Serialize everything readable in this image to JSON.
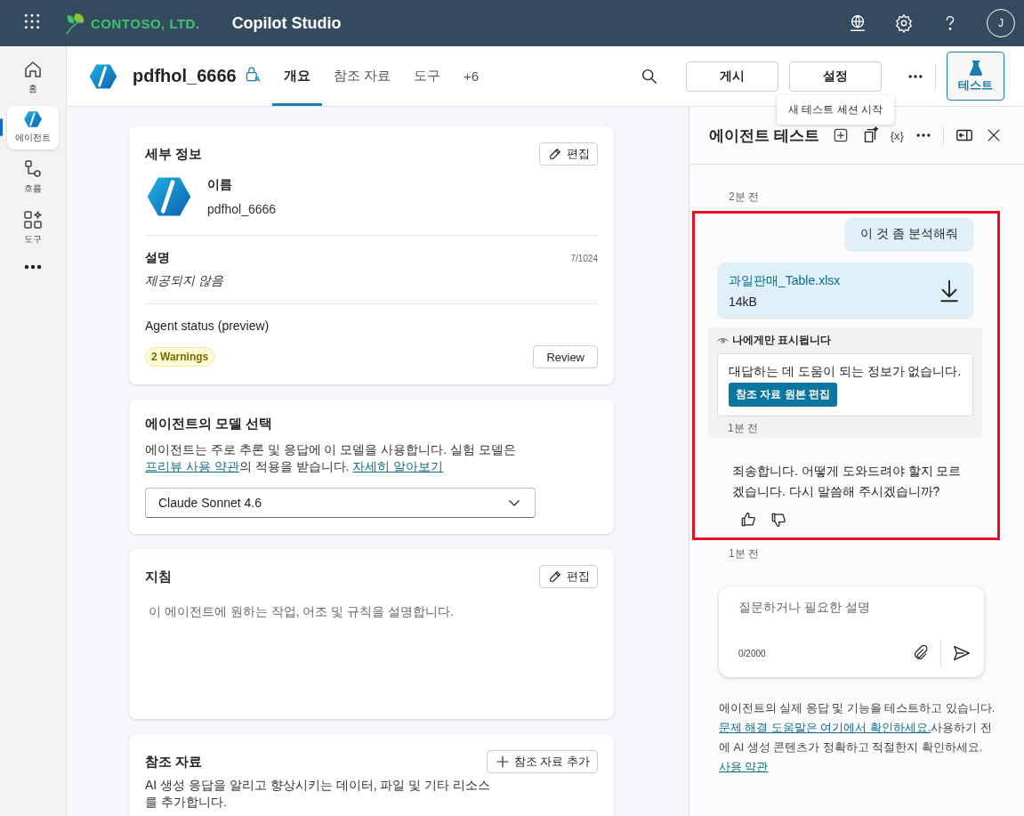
{
  "topbar": {
    "org": "CONTOSO, LTD.",
    "app": "Copilot Studio",
    "avatar": "J"
  },
  "rail": [
    {
      "kind": "home",
      "label": "홈",
      "selected": false
    },
    {
      "kind": "agent",
      "label": "에이전트",
      "selected": true
    },
    {
      "kind": "flow",
      "label": "흐름",
      "selected": false
    },
    {
      "kind": "tools",
      "label": "도구",
      "selected": false
    }
  ],
  "header": {
    "agent_name": "pdfhol_6666",
    "tabs": [
      {
        "label": "개요",
        "selected": true
      },
      {
        "label": "참조 자료",
        "selected": false
      },
      {
        "label": "도구",
        "selected": false
      },
      {
        "label": "+6",
        "selected": false
      }
    ],
    "buttons": [
      "게시",
      "설정"
    ],
    "test_button": "테스트",
    "tooltip": "새 테스트 세션 시작"
  },
  "details": {
    "title": "세부 정보",
    "edit": "편집",
    "name_label": "이름",
    "name_value": "pdfhol_6666",
    "desc_label": "설명",
    "desc_count": "7/1024",
    "desc_value": "제공되지 않음",
    "status_label": "Agent status (preview)",
    "warnings": "2 Warnings",
    "review": "Review"
  },
  "model": {
    "title": "에이전트의 모델 선택",
    "description": [
      {
        "kind": "text",
        "text": "에이전트는 주로 추론 및 응답에 이 모델을 사용합니다. 실험 모델은 "
      },
      {
        "kind": "link",
        "text": "프리뷰 사용 약관"
      },
      {
        "kind": "text",
        "text": "의 적용을 받습니다. "
      },
      {
        "kind": "link",
        "text": "자세히 알아보기"
      }
    ],
    "selected_model": "Claude Sonnet 4.6"
  },
  "instructions": {
    "title": "지침",
    "edit": "편집",
    "hint": "이 에이전트에 원하는 작업, 어조 및 규칙을 설명합니다."
  },
  "knowledge": {
    "title": "참조 자료",
    "add": "참조 자료 추가",
    "text": "AI 생성 응답을 알리고 향상시키는 데이터, 파일 및 기타 리소스를 추가합니다."
  },
  "test_panel": {
    "title": "에이전트 테스트",
    "variables": "{x}",
    "time_before": "2분 전",
    "highlighted": [
      {
        "kind": "user",
        "text": "이 것 좀 분석해줘"
      },
      {
        "kind": "file",
        "name": "과일판매_Table.xlsx",
        "size": "14kB"
      },
      {
        "kind": "private",
        "label": "나에게만 표시됩니다",
        "text": "대답하는 데 도움이 되는 정보가 없습니다.",
        "button": "참조 자료 원본 편집",
        "time": "1분 전"
      },
      {
        "kind": "bot",
        "text": "죄송합니다. 어떻게 도와드려야 할지 모르겠습니다. 다시 말씀해 주시겠습니까?"
      }
    ],
    "time_after": "1분 전",
    "input": {
      "placeholder": "질문하거나 필요한 설명",
      "counter": "0/2000"
    },
    "disclaimer": [
      {
        "kind": "text",
        "text": "에이전트의 실제 응답 및 기능을 테스트하고 있습니다. "
      },
      {
        "kind": "link",
        "text": "문제 해결 도움말은 여기에서 확인하세요."
      },
      {
        "kind": "text",
        "text": "사용하기 전에 AI 생성 콘텐츠가 정확하고 적절한지 확인하세요. "
      },
      {
        "kind": "link",
        "text": "사용 약관"
      }
    ]
  }
}
